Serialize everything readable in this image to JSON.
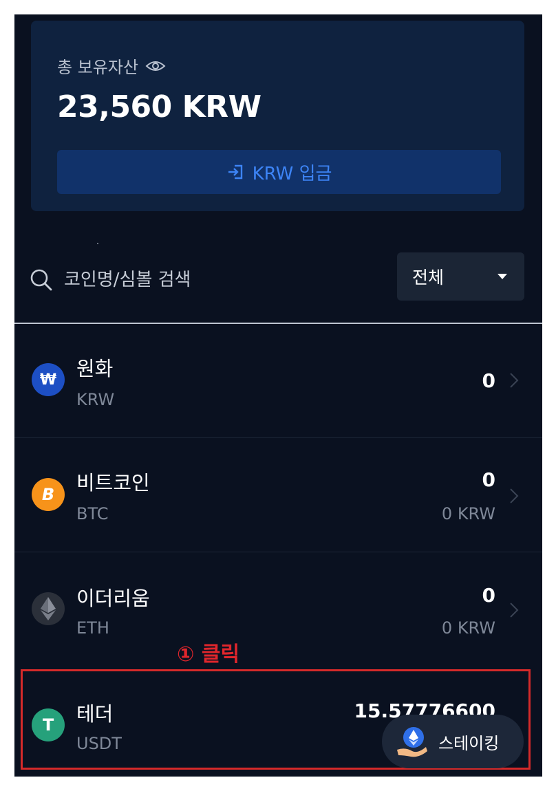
{
  "asset_summary": {
    "label": "총 보유자산",
    "total": "23,560 KRW",
    "deposit_button": "KRW 입금"
  },
  "search": {
    "placeholder": "코인명/심볼 검색"
  },
  "filter": {
    "selected": "전체"
  },
  "coins": [
    {
      "name": "원화",
      "symbol": "KRW",
      "quantity": "0",
      "krw_value": "",
      "icon": "won-icon",
      "icon_glyph": "₩",
      "color": "#1d4fc4"
    },
    {
      "name": "비트코인",
      "symbol": "BTC",
      "quantity": "0",
      "krw_value": "0 KRW",
      "icon": "bitcoin-icon",
      "icon_glyph": "B",
      "color": "#f7931a"
    },
    {
      "name": "이더리움",
      "symbol": "ETH",
      "quantity": "0",
      "krw_value": "0 KRW",
      "icon": "ethereum-icon",
      "icon_glyph": "",
      "color": "#3a3f4a"
    },
    {
      "name": "테더",
      "symbol": "USDT",
      "quantity": "15.57776600",
      "krw_value": "",
      "icon": "tether-icon",
      "icon_glyph": "T",
      "color": "#26a17b"
    }
  ],
  "annotation": {
    "text": "① 클릭",
    "color": "#e0262c"
  },
  "staking_button": {
    "label": "스테이킹"
  },
  "colors": {
    "background": "#0a1120",
    "card": "#0f223f",
    "accent": "#3d84f6"
  }
}
